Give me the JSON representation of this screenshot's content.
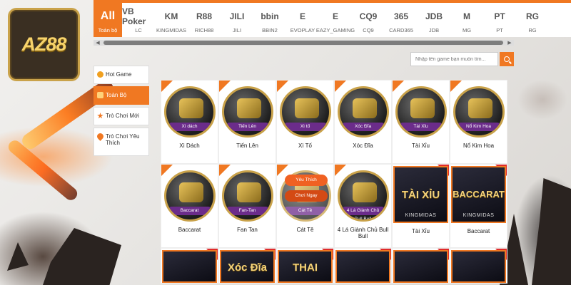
{
  "brand": {
    "logo_text": "AZ88",
    "accent": "#f07822"
  },
  "providers": [
    {
      "logo": "All",
      "label": "Toàn bộ"
    },
    {
      "logo": "VB Poker",
      "label": "LC"
    },
    {
      "logo": "KM",
      "label": "KINGMIDAS"
    },
    {
      "logo": "R88",
      "label": "RICH88"
    },
    {
      "logo": "JILI",
      "label": "JILI"
    },
    {
      "logo": "bbin",
      "label": "BBIN2"
    },
    {
      "logo": "E",
      "label": "EVOPLAY"
    },
    {
      "logo": "E",
      "label": "EAZY_GAMING"
    },
    {
      "logo": "CQ9",
      "label": "CQ9"
    },
    {
      "logo": "365",
      "label": "CARD365"
    },
    {
      "logo": "JDB",
      "label": "JDB"
    },
    {
      "logo": "M",
      "label": "MG"
    },
    {
      "logo": "PT",
      "label": "PT"
    },
    {
      "logo": "RG",
      "label": "RG"
    }
  ],
  "search": {
    "placeholder": "Nhập tên game bạn muốn tìm..."
  },
  "sidebar": {
    "items": [
      {
        "label": "Hot Game"
      },
      {
        "label": "Toàn Bộ"
      },
      {
        "label": "Trò Chơi Mới"
      },
      {
        "label": "Trò Chơi Yêu Thích"
      }
    ]
  },
  "games": [
    {
      "name": "Xì Dách",
      "ribbon": "Xì dách"
    },
    {
      "name": "Tiến Lên",
      "ribbon": "Tiến Lên"
    },
    {
      "name": "Xì Tố",
      "ribbon": "Xì tố"
    },
    {
      "name": "Xóc Đĩa",
      "ribbon": "Xóc Đĩa"
    },
    {
      "name": "Tài Xỉu",
      "ribbon": "Tài Xỉu"
    },
    {
      "name": "Nổ Kim Hoa",
      "ribbon": "Nổ Kim Hoa"
    },
    {
      "name": "Baccarat",
      "ribbon": "Baccarat"
    },
    {
      "name": "Fan Tan",
      "ribbon": "Fan-Tan"
    },
    {
      "name": "Cát Tê",
      "ribbon": "Cát Tê"
    },
    {
      "name": "4 Lá Giành Chủ Bull Bull",
      "ribbon": "4 Lá Giành Chủ Bull Bull"
    },
    {
      "name": "Tài Xỉu",
      "big": "TÀI XỈU",
      "sub": "KINGMIDAS"
    },
    {
      "name": "Baccarat",
      "big": "BACCARAT",
      "sub": "KINGMIDAS"
    }
  ],
  "row3": [
    {
      "title": ""
    },
    {
      "title": "Xóc Đĩa"
    },
    {
      "title": "THAI"
    },
    {
      "title": ""
    },
    {
      "title": ""
    },
    {
      "title": ""
    }
  ],
  "overlay": {
    "favorite": "Yêu Thích",
    "play": "Chơi Ngay"
  }
}
